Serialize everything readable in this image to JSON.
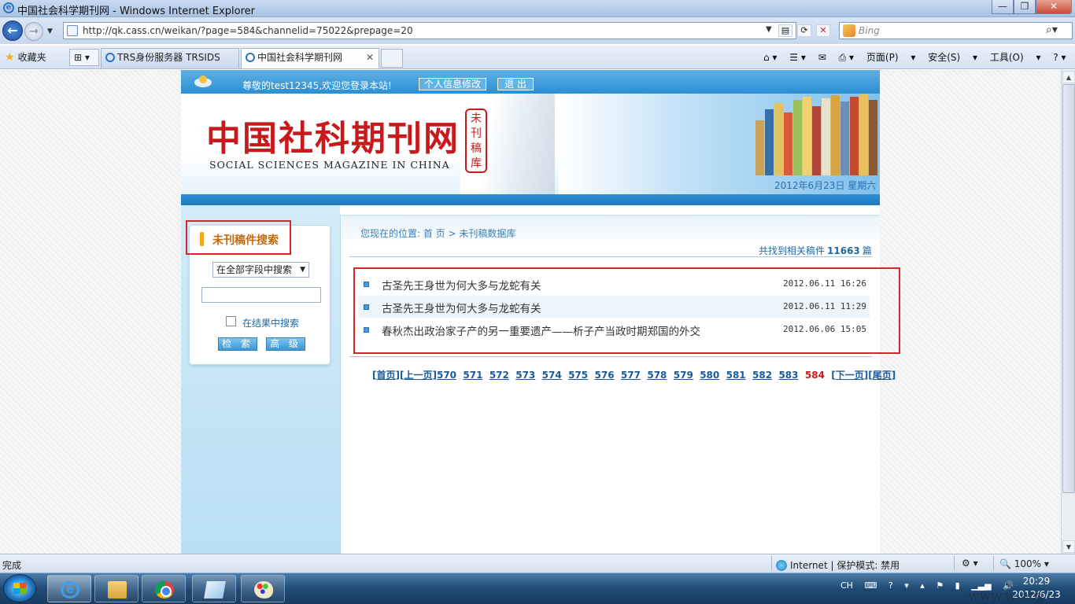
{
  "window": {
    "title": "中国社会科学期刊网 - Windows Internet Explorer",
    "minimize": "—",
    "maximize": "❐",
    "close": "✕"
  },
  "address_bar": {
    "url": "http://qk.cass.cn/weikan/?page=584&channelid=75022&prepage=20"
  },
  "search_bar": {
    "placeholder": "Bing"
  },
  "favorites": {
    "label": "收藏夹"
  },
  "tabs": [
    {
      "label": "TRS身份服务器 TRSIDS",
      "active": false
    },
    {
      "label": "中国社会科学期刊网",
      "active": true
    }
  ],
  "command_bar": {
    "page": "页面(P)",
    "safety": "安全(S)",
    "tools": "工具(O)"
  },
  "site": {
    "greeting": "尊敬的test12345,欢迎您登录本站!",
    "profile_button": "个人信息修改",
    "logout_button": "退 出",
    "title": "中国社科期刊网",
    "subtitle": "SOCIAL SCIENCES MAGAZINE IN CHINA",
    "seal": "未刊稿库",
    "date": "2012年6月23日 星期六"
  },
  "sidebar": {
    "heading": "未刊稿件搜索",
    "field_select": "在全部字段中搜索",
    "keyword_value": "",
    "in_results_label": "在结果中搜索",
    "search_button": "检 索",
    "advanced_button": "高 级"
  },
  "main": {
    "breadcrumb": "您现在的位置: 首 页 > 未刊稿数据库",
    "found_prefix": "共找到相关稿件",
    "found_count": "11663",
    "found_suffix": "篇",
    "results": [
      {
        "title": "古圣先王身世为何大多与龙蛇有关",
        "date": "2012.06.11 16:26"
      },
      {
        "title": "古圣先王身世为何大多与龙蛇有关",
        "date": "2012.06.11 11:29"
      },
      {
        "title": "春秋杰出政治家子产的另一重要遗产——析子产当政时期郑国的外交",
        "date": "2012.06.06 15:05"
      }
    ],
    "pager": {
      "first": "首页",
      "prev": "上一页",
      "pages": [
        "570",
        "571",
        "572",
        "573",
        "574",
        "575",
        "576",
        "577",
        "578",
        "579",
        "580",
        "581",
        "582",
        "583"
      ],
      "current": "584",
      "next": "下一页",
      "last": "尾页"
    }
  },
  "status_bar": {
    "text": "完成",
    "zone": "Internet | 保护模式: 禁用",
    "zoom": "100%"
  },
  "taskbar": {
    "tray_lang": "CH",
    "time": "20:29",
    "date": "2012/6/23"
  },
  "watermark": "www.w          org"
}
